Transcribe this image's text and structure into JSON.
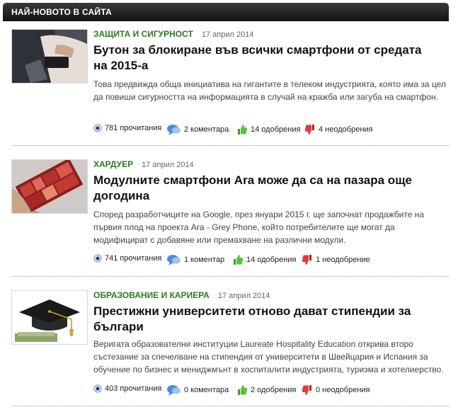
{
  "header": {
    "title": "НАЙ-НОВОТО В САЙТА"
  },
  "articles": [
    {
      "category": "ЗАЩИТА И СИГУРНОСТ",
      "date": "17 април 2014",
      "title": "Бутон за блокиране във всички смартфони от средата на 2015-а",
      "summary": "Това предвижда обща инициатива на гигантите в телеком индустрията, която има за цел да повиши сигурността на информацията в случай на кражба или загуба на смартфон.",
      "views": "781 прочитания",
      "comments": "2 коментара",
      "likes": "14 одобрения",
      "dislikes": "4 неодобрения"
    },
    {
      "category": "ХАРДУЕР",
      "date": "17 април 2014",
      "title": "Модулните смартфони Ara може да са на пазара още догодина",
      "summary": "Според разработчиците на Google, през януари 2015 г. ще започнат продажбите на първия плод на проекта Ara - Grey Phone, който потребителите ще могат да модифицират с добавяне или премахване на различни модули.",
      "views": "741 прочитания",
      "comments": "1 коментар",
      "likes": "14 одобрения",
      "dislikes": "1 неодобрение"
    },
    {
      "category": "ОБРАЗОВАНИЕ И КАРИЕРА",
      "date": "17 април 2014",
      "title": "Престижни университети отново дават стипендии за българи",
      "summary": "Веригата образователни институции Laureate Hospitality Education открива второ състезание за спечелване на стипендия от университети в Швейцария и Испания за обучение по бизнес и мениджмънт в хоспиталити индустрията, туризма и хотелиерство.",
      "views": "403 прочитания",
      "comments": "0 коментара",
      "likes": "2 одобрения",
      "dislikes": "0 неодобрения"
    }
  ]
}
